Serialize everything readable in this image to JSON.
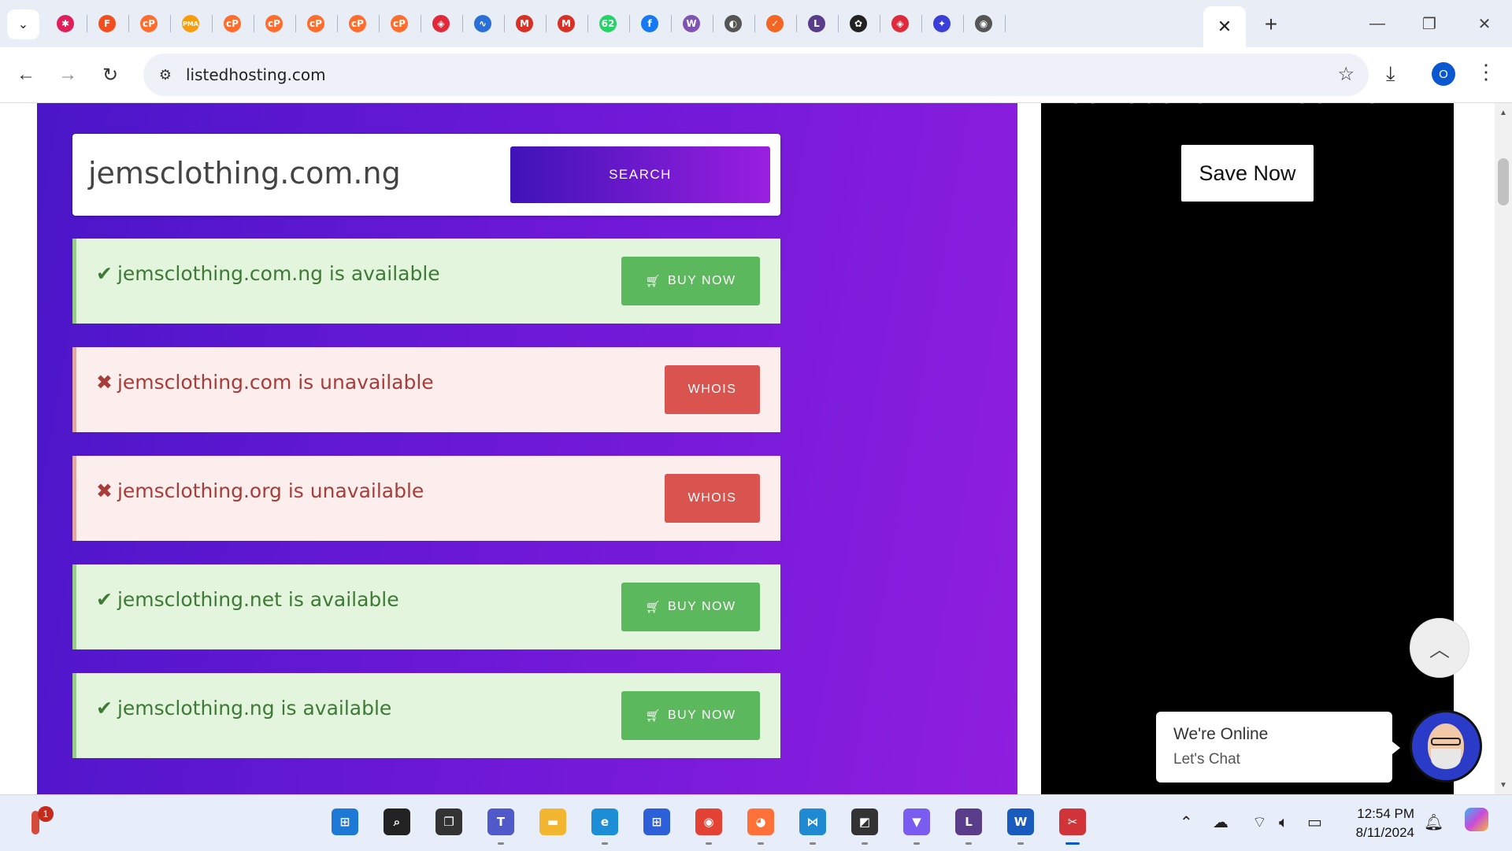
{
  "browser": {
    "tabs": [
      {
        "icon": "slack-icon",
        "glyph": "✱",
        "color": "#e01e5a"
      },
      {
        "icon": "figma-icon",
        "glyph": "F",
        "color": "#f24e1e"
      },
      {
        "icon": "cpanel-icon",
        "glyph": "cP",
        "color": "#ff6c2c"
      },
      {
        "icon": "phpmyadmin-icon",
        "glyph": "PMA",
        "color": "#f89c0e"
      },
      {
        "icon": "cpanel-icon",
        "glyph": "cP",
        "color": "#ff6c2c"
      },
      {
        "icon": "cpanel-icon",
        "glyph": "cP",
        "color": "#ff6c2c"
      },
      {
        "icon": "cpanel-icon",
        "glyph": "cP",
        "color": "#ff6c2c"
      },
      {
        "icon": "cpanel-icon",
        "glyph": "cP",
        "color": "#ff6c2c"
      },
      {
        "icon": "cpanel-icon",
        "glyph": "cP",
        "color": "#ff6c2c"
      },
      {
        "icon": "cube-icon",
        "glyph": "◈",
        "color": "#e0293a"
      },
      {
        "icon": "waveform-icon",
        "glyph": "∿",
        "color": "#2b6fd6"
      },
      {
        "icon": "gmail-icon",
        "glyph": "M",
        "color": "#d93025"
      },
      {
        "icon": "gmail-icon",
        "glyph": "M",
        "color": "#d93025"
      },
      {
        "icon": "whatsapp-icon",
        "glyph": "62",
        "color": "#25d366"
      },
      {
        "icon": "facebook-icon",
        "glyph": "f",
        "color": "#1877f2"
      },
      {
        "icon": "woocommerce-icon",
        "glyph": "W",
        "color": "#7f54b3"
      },
      {
        "icon": "globe-icon",
        "glyph": "◐",
        "color": "#555555"
      },
      {
        "icon": "orange-app-icon",
        "glyph": "✓",
        "color": "#f26522"
      },
      {
        "icon": "clockify-icon",
        "glyph": "L",
        "color": "#5a3d8a"
      },
      {
        "icon": "openai-icon",
        "glyph": "✿",
        "color": "#222222"
      },
      {
        "icon": "cube-icon",
        "glyph": "◈",
        "color": "#e0293a"
      },
      {
        "icon": "ai-sparkle-icon",
        "glyph": "✦",
        "color": "#3b3fd8"
      },
      {
        "icon": "chrome-icon",
        "glyph": "◉",
        "color": "#555555"
      }
    ],
    "active_tab_close": "✕",
    "new_tab": "+",
    "url": "listedhosting.com",
    "profile_initial": "O"
  },
  "page": {
    "search": {
      "value": "jemsclothing.com.ng",
      "button": "SEARCH"
    },
    "results": [
      {
        "status": "available",
        "text": "jemsclothing.com.ng is available",
        "button": "BUY NOW"
      },
      {
        "status": "unavailable",
        "text": "jemsclothing.com is unavailable",
        "button": "WHOIS"
      },
      {
        "status": "unavailable",
        "text": "jemsclothing.org is unavailable",
        "button": "WHOIS"
      },
      {
        "status": "available",
        "text": "jemsclothing.net is available",
        "button": "BUY NOW"
      },
      {
        "status": "available",
        "text": "jemsclothing.ng is available",
        "button": "BUY NOW"
      }
    ],
    "promo": {
      "coupon": "USE COUPON: WELCOMESALE",
      "button": "Save Now"
    },
    "chat": {
      "line1": "We're Online",
      "line2": "Let's Chat"
    },
    "colors": {
      "available_bg": "#e3f5dc",
      "unavailable_bg": "#fbeeed",
      "buy_button": "#5cb85c",
      "whois_button": "#d9534f"
    }
  },
  "taskbar": {
    "weather_badge": "1",
    "apps": [
      {
        "icon": "windows-start-icon",
        "glyph": "⊞",
        "color": "#1e78d6"
      },
      {
        "icon": "search-icon",
        "glyph": "⌕",
        "color": "#222222"
      },
      {
        "icon": "task-view-icon",
        "glyph": "❐",
        "color": "#333333"
      },
      {
        "icon": "teams-icon",
        "glyph": "T",
        "color": "#5059c9"
      },
      {
        "icon": "file-explorer-icon",
        "glyph": "▬",
        "color": "#f2b630"
      },
      {
        "icon": "edge-icon",
        "glyph": "e",
        "color": "#1b8ed6"
      },
      {
        "icon": "microsoft-store-icon",
        "glyph": "⊞",
        "color": "#2d5fd8"
      },
      {
        "icon": "chrome-icon",
        "glyph": "◉",
        "color": "#e34133"
      },
      {
        "icon": "firefox-icon",
        "glyph": "◕",
        "color": "#ff7139"
      },
      {
        "icon": "vscode-icon",
        "glyph": "⋈",
        "color": "#1f8ad2"
      },
      {
        "icon": "sticky-notes-icon",
        "glyph": "◩",
        "color": "#333333"
      },
      {
        "icon": "vpn-icon",
        "glyph": "▼",
        "color": "#7b5cf0"
      },
      {
        "icon": "clockify-icon",
        "glyph": "L",
        "color": "#5a3d8a"
      },
      {
        "icon": "word-icon",
        "glyph": "W",
        "color": "#185abd"
      },
      {
        "icon": "snipping-tool-icon",
        "glyph": "✂",
        "color": "#d13438"
      }
    ],
    "time": "12:54 PM",
    "date": "8/11/2024"
  }
}
